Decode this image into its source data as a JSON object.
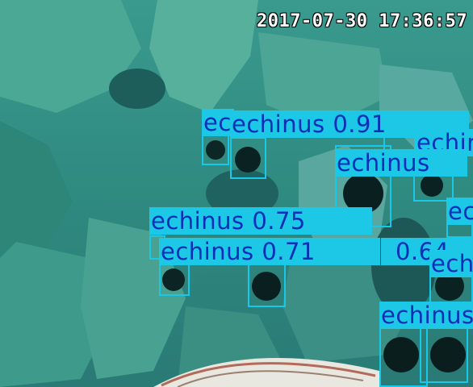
{
  "timestamp": "2017-07-30  17:36:57",
  "colors": {
    "box": "#18c8e8",
    "label_bg": "#1cc8e6",
    "label_text": "#0b2fb8",
    "water": "#2f8c84"
  },
  "detections": [
    {
      "class": "echinus",
      "score": "0.91"
    },
    {
      "class": "echinus",
      "score": "0.75"
    },
    {
      "class": "echinus",
      "score": "0.71"
    },
    {
      "class": "echinus",
      "score": "0.64"
    },
    {
      "class": "echinus",
      "score": ""
    },
    {
      "class": "echinus",
      "score": ""
    },
    {
      "class": "echinus",
      "score": ""
    },
    {
      "class": "echinus",
      "score": ""
    },
    {
      "class": "echinus",
      "score": ""
    },
    {
      "class": "echinus",
      "score": ""
    }
  ]
}
